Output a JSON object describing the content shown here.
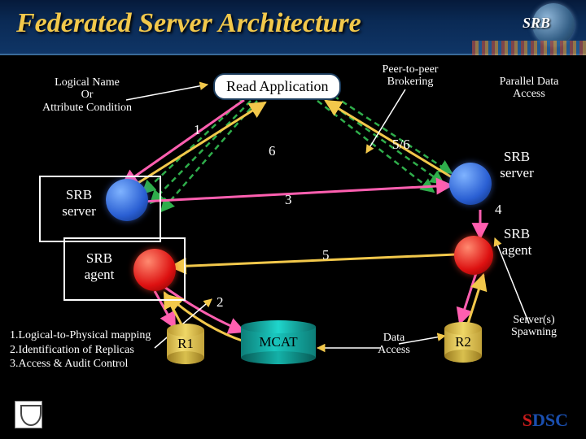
{
  "header": {
    "title": "Federated Server Architecture",
    "logo_text": "SRB"
  },
  "labels": {
    "logical_name_1": "Logical Name",
    "logical_name_2": "Or",
    "logical_name_3": "Attribute Condition",
    "read_application": "Read Application",
    "p2p_1": "Peer-to-peer",
    "p2p_2": "Brokering",
    "parallel_1": "Parallel Data",
    "parallel_2": "Access",
    "srb_server_left": "SRB",
    "srb_server_left2": "server",
    "srb_agent_left": "SRB",
    "srb_agent_left2": "agent",
    "srb_server_right": "SRB",
    "srb_server_right2": "server",
    "srb_agent_right": "SRB",
    "srb_agent_right2": "agent",
    "data_access_1": "Data",
    "data_access_2": "Access",
    "spawn_1": "Server(s)",
    "spawn_2": "Spawning"
  },
  "numbers": {
    "n1": "1",
    "n2": "2",
    "n3": "3",
    "n4": "4",
    "n5": "5",
    "n6": "6",
    "n56": "5/6"
  },
  "components": {
    "r1": "R1",
    "r2": "R2",
    "mcat": "MCAT"
  },
  "mcat_list": {
    "l1": "1.Logical-to-Physical mapping",
    "l2": "2.Identification of Replicas",
    "l3": "3.Access & Audit Control"
  },
  "footer": {
    "sdsc_s": "S",
    "sdsc_rest": "DSC"
  }
}
